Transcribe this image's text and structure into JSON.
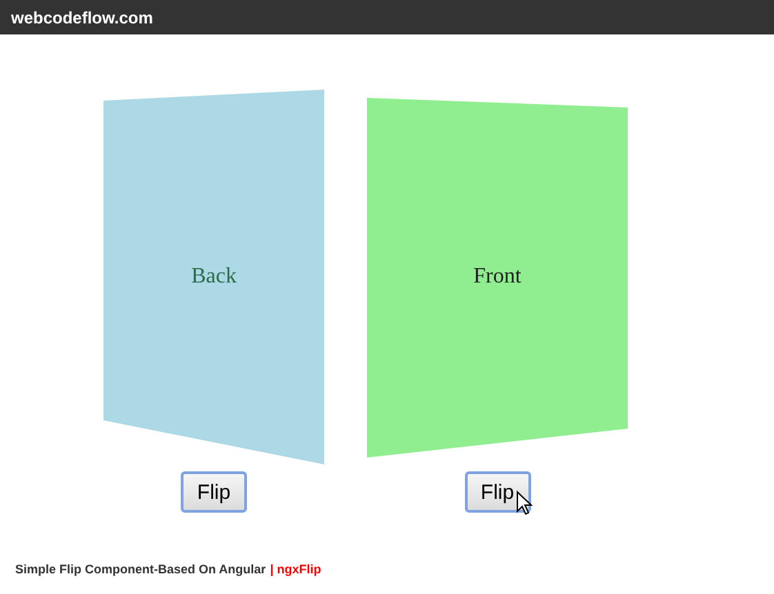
{
  "header": {
    "title": "webcodeflow.com"
  },
  "cards": [
    {
      "kind": "back",
      "label": "Back",
      "color": "#add8e6",
      "button": "Flip",
      "hovered": false
    },
    {
      "kind": "front",
      "label": "Front",
      "color": "#90ee90",
      "button": "Flip",
      "hovered": true
    }
  ],
  "footer": {
    "title": "Simple Flip Component-Based On Angular",
    "link": "| ngxFlip"
  }
}
